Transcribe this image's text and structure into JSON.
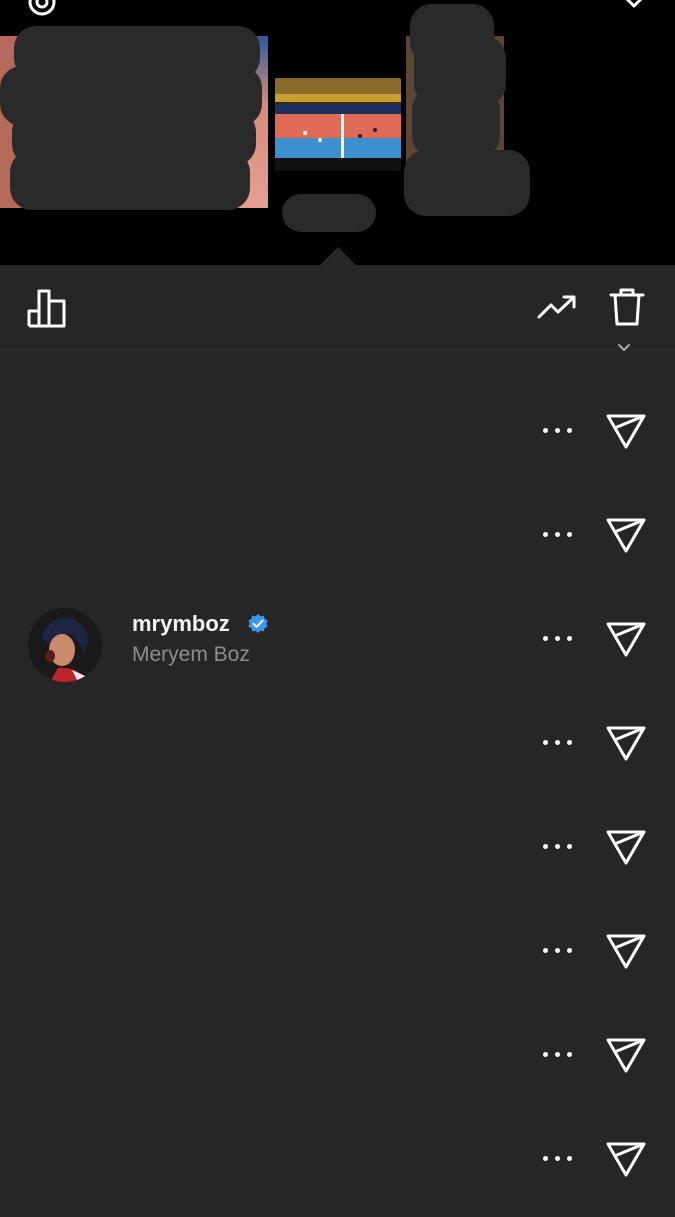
{
  "viewers": [
    {
      "username": "",
      "full_name": ""
    },
    {
      "username": "",
      "full_name": ""
    },
    {
      "username": "mrymboz",
      "full_name": "Meryem Boz",
      "verified": true
    },
    {
      "username": "",
      "full_name": ""
    },
    {
      "username": "",
      "full_name": ""
    },
    {
      "username": "",
      "full_name": ""
    },
    {
      "username": "",
      "full_name": ""
    },
    {
      "username": "",
      "full_name": ""
    }
  ],
  "icons": {
    "settings": "gear-icon",
    "close": "close-icon",
    "insights": "bar-chart-icon",
    "boost": "trending-up-icon",
    "delete": "trash-icon",
    "more": "more-horizontal-icon",
    "send": "send-icon",
    "verified": "verified-badge-icon"
  },
  "colors": {
    "background": "#262626",
    "header": "#000000",
    "secondary_text": "#8e8e8e",
    "verified": "#3897f0"
  }
}
